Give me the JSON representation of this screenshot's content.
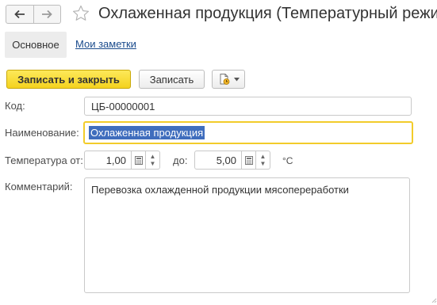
{
  "header": {
    "title": "Охлаженная продукция (Температурный режим)",
    "back_icon": "arrow-left-icon",
    "forward_icon": "arrow-right-icon",
    "favorite_icon": "star-outline-icon"
  },
  "tabs": [
    {
      "label": "Основное",
      "active": true
    },
    {
      "label": "Мои заметки",
      "active": false
    }
  ],
  "toolbar": {
    "save_close_label": "Записать и закрыть",
    "save_label": "Записать",
    "report_icon": "document-clock-icon",
    "dropdown_icon": "chevron-down-icon"
  },
  "form": {
    "code_label": "Код:",
    "code_value": "ЦБ-00000001",
    "name_label": "Наименование:",
    "name_value": "Охлаженная продукция",
    "temp_from_label": "Температура от:",
    "temp_from_value": "1,00",
    "temp_to_label": "до:",
    "temp_to_value": "5,00",
    "temp_unit": "°C",
    "comment_label": "Комментарий:",
    "comment_value": "Перевозка охлажденной продукции мясопереработки"
  },
  "colors": {
    "primary_button": "#f4d21e",
    "focus_border": "#f2cc2a",
    "selection": "#3f6dbd",
    "link": "#1a4b8c"
  }
}
